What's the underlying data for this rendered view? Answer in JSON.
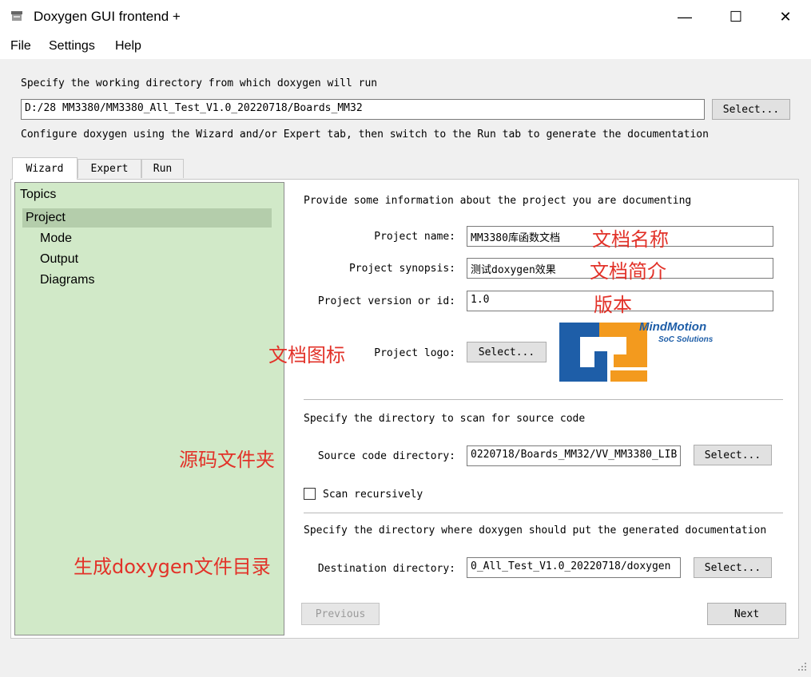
{
  "window": {
    "title": "Doxygen GUI frontend +",
    "icon": "doxygen-app-icon",
    "controls": {
      "minimize": "—",
      "maximize": "☐",
      "close": "✕"
    }
  },
  "menu": [
    "File",
    "Settings",
    "Help"
  ],
  "working_dir": {
    "prompt": "Specify the working directory from which doxygen will run",
    "value": "D:/28 MM3380/MM3380_All_Test_V1.0_20220718/Boards_MM32",
    "select_label": "Select..."
  },
  "hint": "Configure doxygen using the Wizard and/or Expert tab, then switch to the Run tab to generate the documentation",
  "tabs": [
    "Wizard",
    "Expert",
    "Run"
  ],
  "topics": {
    "header": "Topics",
    "items": [
      "Project",
      "Mode",
      "Output",
      "Diagrams"
    ],
    "selected": "Project"
  },
  "project": {
    "intro": "Provide some information about the project you are documenting",
    "name_label": "Project name:",
    "name_value": "MM3380库函数文档",
    "synopsis_label": "Project synopsis:",
    "synopsis_value": "测试doxygen效果",
    "version_label": "Project version or id:",
    "version_value": "1.0",
    "logo_label": "Project logo:",
    "logo_select": "Select...",
    "logo": {
      "brand": "MindMotion",
      "tagline": "SoC Solutions",
      "colors": {
        "blue": "#1e5ea8",
        "orange": "#f39a1e"
      }
    }
  },
  "source": {
    "intro": "Specify the directory to scan for source code",
    "label": "Source code directory:",
    "value": "0220718/Boards_MM32/VV_MM3380_LIB",
    "select_label": "Select...",
    "recursive_label": "Scan recursively",
    "recursive_checked": false
  },
  "destination": {
    "intro": "Specify the directory where doxygen should put the generated documentation",
    "label": "Destination directory:",
    "value": "0_All_Test_V1.0_20220718/doxygen",
    "select_label": "Select..."
  },
  "nav": {
    "previous": "Previous",
    "next": "Next"
  },
  "annotations": {
    "name": "文档名称",
    "synopsis": "文档简介",
    "version": "版本",
    "logo": "文档图标",
    "source": "源码文件夹",
    "destination": "生成doxygen文件目录",
    "color": "#e23229"
  }
}
